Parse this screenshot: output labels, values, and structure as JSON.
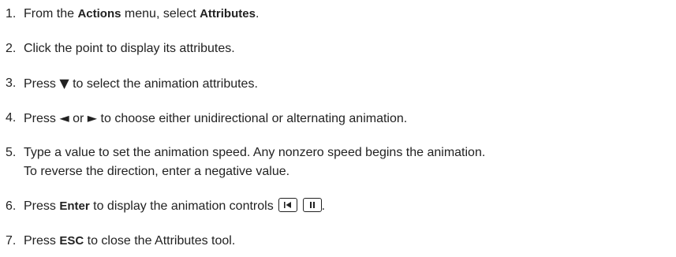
{
  "steps": [
    {
      "number": "1.",
      "parts": [
        "From the ",
        "Actions",
        " menu, select ",
        "Attributes",
        "."
      ]
    },
    {
      "number": "2.",
      "text": "Click the point to display its attributes."
    },
    {
      "number": "3.",
      "parts": [
        "Press ",
        "▼",
        " to select the animation attributes."
      ]
    },
    {
      "number": "4.",
      "parts": [
        "Press ",
        "◄",
        " or ",
        "►",
        " to choose either unidirectional or alternating animation."
      ]
    },
    {
      "number": "5.",
      "line1": "Type a value to set the animation speed. Any nonzero speed begins the animation.",
      "line2": "To reverse the direction, enter a negative value."
    },
    {
      "number": "6.",
      "parts": [
        "Press ",
        "Enter",
        " to display the animation controls ",
        "."
      ],
      "controls": [
        "reset-icon",
        "pause-icon"
      ]
    },
    {
      "number": "7.",
      "parts": [
        "Press ",
        "ESC",
        " to close the Attributes tool."
      ]
    }
  ]
}
